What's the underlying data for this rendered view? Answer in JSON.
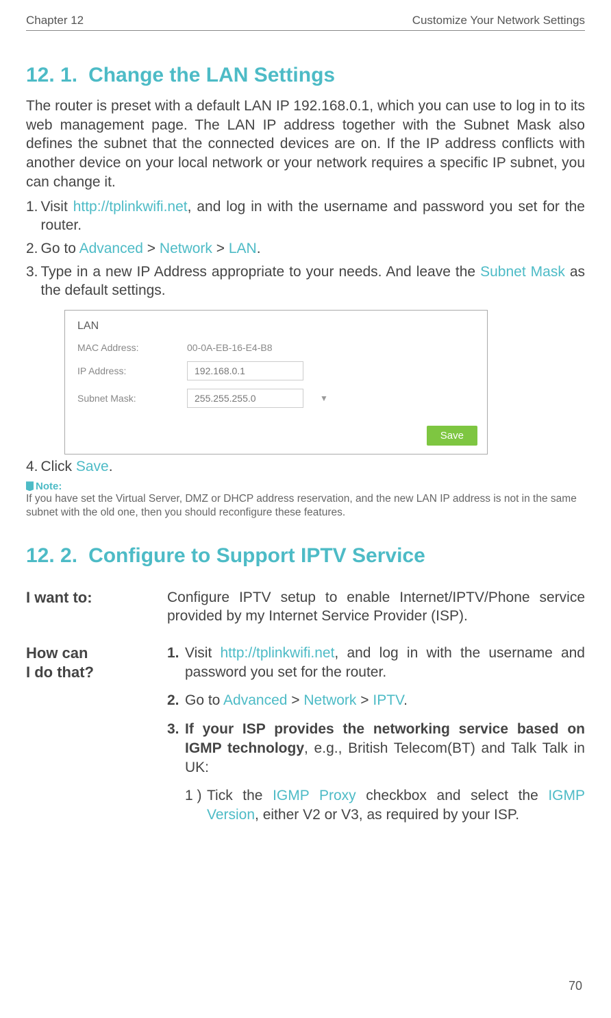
{
  "header": {
    "left": "Chapter 12",
    "right": "Customize Your Network Settings"
  },
  "section1": {
    "num": "12. 1.",
    "title": "Change the LAN Settings",
    "intro": "The router is preset with a default LAN IP 192.168.0.1, which you can use to log in to its web management page. The LAN IP address together with the Subnet Mask also defines the subnet that the connected devices are on. If the IP address conflicts with another device on your local network or your network requires a specific IP subnet, you can change it.",
    "steps": {
      "s1_pre": "Visit ",
      "s1_link": "http://tplinkwifi.net",
      "s1_post": ", and log in with the username and password you set for the router.",
      "s2_pre": "Go to ",
      "s2_a": "Advanced",
      "s2_gt1": " > ",
      "s2_b": "Network",
      "s2_gt2": " > ",
      "s2_c": "LAN",
      "s2_end": ".",
      "s3_pre": "Type in a new IP Address appropriate to your needs. And leave the ",
      "s3_link": "Subnet Mask",
      "s3_post": " as the default settings.",
      "s4_pre": "Click ",
      "s4_link": "Save",
      "s4_end": "."
    },
    "note_label": "Note:",
    "note_text": "If you have set the Virtual Server, DMZ or DHCP address reservation, and the new LAN IP address is not in the same subnet with the old one, then you should reconfigure these features."
  },
  "figure": {
    "title": "LAN",
    "mac_label": "MAC Address:",
    "mac_value": "00-0A-EB-16-E4-B8",
    "ip_label": "IP Address:",
    "ip_value": "192.168.0.1",
    "subnet_label": "Subnet Mask:",
    "subnet_value": "255.255.255.0",
    "save": "Save"
  },
  "section2": {
    "num": "12. 2.",
    "title": "Configure to Support IPTV Service",
    "left1": "I want to:",
    "right1": "Configure IPTV setup to enable Internet/IPTV/Phone service provided by my Internet Service Provider (ISP).",
    "left2a": "How can",
    "left2b": "I do that?",
    "r1_pre": "Visit ",
    "r1_link": "http://tplinkwifi.net",
    "r1_post": ", and log in with the username and password you set for the router.",
    "r2_pre": "Go to ",
    "r2_a": "Advanced",
    "r2_gt1": " > ",
    "r2_b": "Network",
    "r2_gt2": " > ",
    "r2_c": "IPTV",
    "r2_end": ".",
    "r3_bold": "If your ISP provides the networking service based on IGMP technology",
    "r3_post": ", e.g., British Telecom(BT) and Talk Talk in UK:",
    "sub1_pre": "Tick the ",
    "sub1_a": "IGMP Proxy",
    "sub1_mid": " checkbox and select the ",
    "sub1_b": "IGMP Version",
    "sub1_post": ", either V2 or V3, as required by your ISP."
  },
  "page_number": "70"
}
